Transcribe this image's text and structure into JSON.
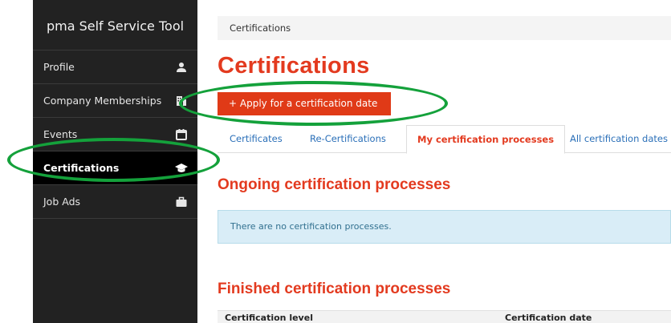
{
  "sidebar": {
    "title": "pma Self Service Tool",
    "items": [
      {
        "label": "Profile",
        "icon": "person-icon"
      },
      {
        "label": "Company Memberships",
        "icon": "building-icon"
      },
      {
        "label": "Events",
        "icon": "calendar-icon"
      },
      {
        "label": "Certifications",
        "icon": "graduation-cap-icon",
        "active": true
      },
      {
        "label": "Job Ads",
        "icon": "briefcase-icon"
      }
    ]
  },
  "breadcrumb": "Certifications",
  "page_title": "Certifications",
  "apply_button": "+ Apply for a certification date",
  "tabs": [
    {
      "label": "Certificates"
    },
    {
      "label": "Re-Certifications"
    },
    {
      "label": "My certification processes",
      "active": true
    },
    {
      "label": "All certification dates"
    }
  ],
  "ongoing": {
    "heading": "Ongoing certification processes",
    "empty_message": "There are no certification processes."
  },
  "finished": {
    "heading": "Finished certification processes",
    "columns": [
      "Certification level",
      "Certification date"
    ]
  },
  "colors": {
    "accent": "#e33a1f",
    "button": "#e03a17",
    "sidebar_bg": "#222222",
    "annotation": "#14a13b",
    "info_bg": "#d9edf7"
  }
}
